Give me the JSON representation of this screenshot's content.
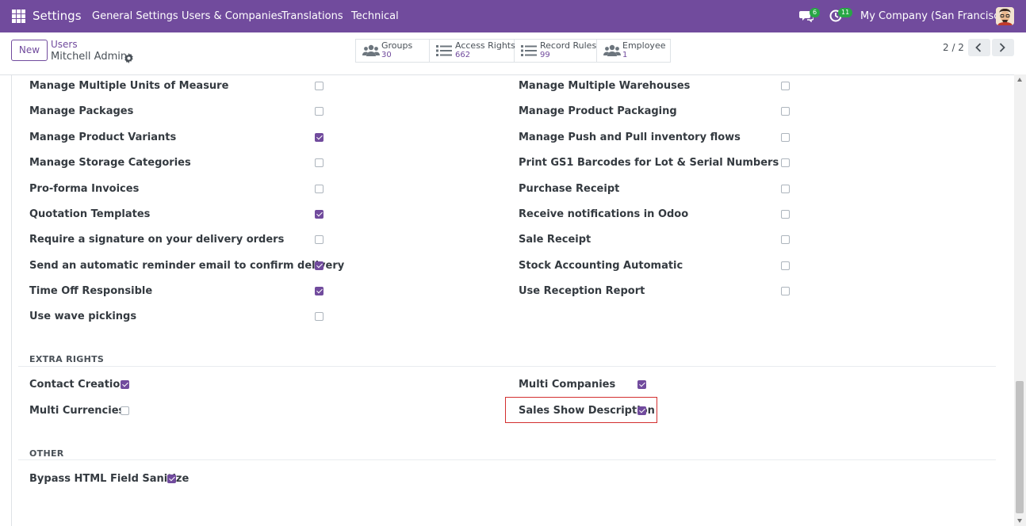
{
  "topbar": {
    "brand": "Settings",
    "menu": [
      "General Settings",
      "Users & Companies",
      "Translations",
      "Technical"
    ],
    "chat_badge": "6",
    "activity_badge": "11",
    "company": "My Company (San Francisco)"
  },
  "control": {
    "new_label": "New",
    "breadcrumb_parent": "Users",
    "breadcrumb_current": "Mitchell Admin",
    "smart_buttons": [
      {
        "label": "Groups",
        "count": "30"
      },
      {
        "label": "Access Rights",
        "count": "662"
      },
      {
        "label": "Record Rules",
        "count": "99"
      },
      {
        "label": "Employee",
        "count": "1"
      }
    ],
    "pager": "2 / 2"
  },
  "rights_left": [
    {
      "label": "Manage Multiple Units of Measure",
      "checked": false
    },
    {
      "label": "Manage Packages",
      "checked": false
    },
    {
      "label": "Manage Product Variants",
      "checked": true
    },
    {
      "label": "Manage Storage Categories",
      "checked": false
    },
    {
      "label": "Pro-forma Invoices",
      "checked": false
    },
    {
      "label": "Quotation Templates",
      "checked": true
    },
    {
      "label": "Require a signature on your delivery orders",
      "checked": false
    },
    {
      "label": "Send an automatic reminder email to confirm delivery",
      "checked": true
    },
    {
      "label": "Time Off Responsible",
      "checked": true
    },
    {
      "label": "Use wave pickings",
      "checked": false
    }
  ],
  "rights_right": [
    {
      "label": "Manage Multiple Warehouses",
      "checked": false
    },
    {
      "label": "Manage Product Packaging",
      "checked": false
    },
    {
      "label": "Manage Push and Pull inventory flows",
      "checked": false
    },
    {
      "label": "Print GS1 Barcodes for Lot & Serial Numbers",
      "checked": false
    },
    {
      "label": "Purchase Receipt",
      "checked": false
    },
    {
      "label": "Receive notifications in Odoo",
      "checked": false
    },
    {
      "label": "Sale Receipt",
      "checked": false
    },
    {
      "label": "Stock Accounting Automatic",
      "checked": false
    },
    {
      "label": "Use Reception Report",
      "checked": false
    }
  ],
  "extra_rights": {
    "title": "EXTRA RIGHTS",
    "left": [
      {
        "label": "Contact Creation",
        "checked": true
      },
      {
        "label": "Multi Currencies",
        "checked": false
      }
    ],
    "right": [
      {
        "label": "Multi Companies",
        "checked": true
      },
      {
        "label": "Sales Show Description",
        "checked": true
      }
    ]
  },
  "other": {
    "title": "OTHER",
    "items": [
      {
        "label": "Bypass HTML Field Sanitize",
        "checked": true
      }
    ]
  },
  "colors": {
    "brand": "#714b9d",
    "highlight": "#d32f2f"
  }
}
